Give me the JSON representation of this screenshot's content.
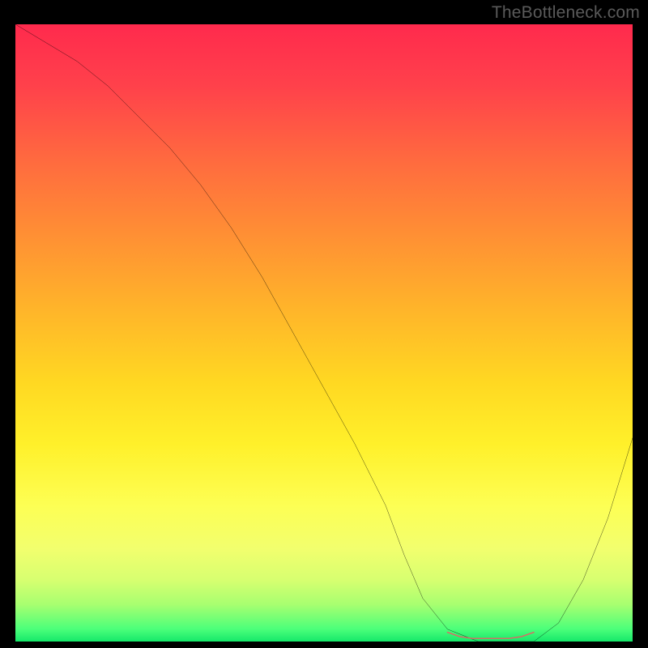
{
  "attribution": "TheBottleneck.com",
  "chart_data": {
    "type": "line",
    "title": "",
    "xlabel": "",
    "ylabel": "",
    "xlim": [
      0,
      100
    ],
    "ylim": [
      0,
      100
    ],
    "series": [
      {
        "name": "bottleneck-curve",
        "x": [
          0,
          5,
          10,
          15,
          20,
          25,
          30,
          35,
          40,
          45,
          50,
          55,
          60,
          63,
          66,
          70,
          75,
          80,
          84,
          88,
          92,
          96,
          100
        ],
        "y": [
          100,
          97,
          94,
          90,
          85,
          80,
          74,
          67,
          59,
          50,
          41,
          32,
          22,
          14,
          7,
          2,
          0,
          0,
          0,
          3,
          10,
          20,
          33
        ]
      },
      {
        "name": "optimal-range-marker",
        "x": [
          70,
          72,
          74,
          76,
          78,
          80,
          82,
          84
        ],
        "y": [
          1.5,
          0.8,
          0.5,
          0.5,
          0.5,
          0.5,
          0.8,
          1.5
        ]
      }
    ],
    "colors": {
      "curve": "#000000",
      "marker": "#e06666",
      "gradient_top": "#ff2a4d",
      "gradient_bottom": "#15e86a"
    }
  }
}
